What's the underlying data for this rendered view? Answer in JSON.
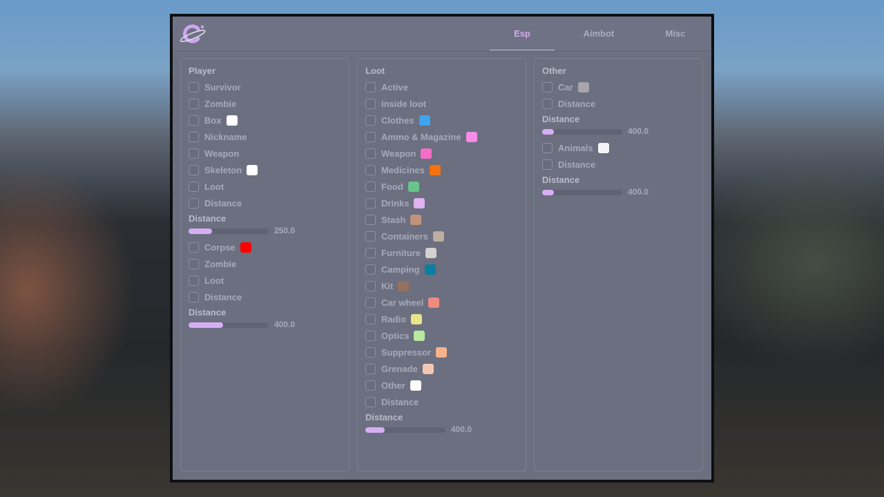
{
  "tabs": [
    {
      "label": "Esp",
      "active": true
    },
    {
      "label": "Aimbot",
      "active": false
    },
    {
      "label": "Misc",
      "active": false
    }
  ],
  "colors": {
    "accent": "#d7aef4",
    "panel_bg": "#6b6f80",
    "text": "#a6aab8"
  },
  "logo": {
    "icon": "planet-c-logo"
  },
  "player": {
    "title": "Player",
    "items": [
      {
        "label": "Survivor",
        "checked": false
      },
      {
        "label": "Zombie",
        "checked": false
      },
      {
        "label": "Box",
        "checked": false,
        "color": "#ffffff"
      },
      {
        "label": "Nickname",
        "checked": false
      },
      {
        "label": "Weapon",
        "checked": false
      },
      {
        "label": "Skeleton",
        "checked": false,
        "color": "#ffffff"
      },
      {
        "label": "Loot",
        "checked": false
      },
      {
        "label": "Distance",
        "checked": false
      }
    ],
    "slider1": {
      "label": "Distance",
      "value_text": "250.0",
      "fraction": 0.29
    },
    "items2": [
      {
        "label": "Corpse",
        "checked": false,
        "color": "#ff0000"
      },
      {
        "label": "Zombie",
        "checked": false
      },
      {
        "label": "Loot",
        "checked": false
      },
      {
        "label": "Distance",
        "checked": false
      }
    ],
    "slider2": {
      "label": "Distance",
      "value_text": "400.0",
      "fraction": 0.43
    }
  },
  "loot": {
    "title": "Loot",
    "items": [
      {
        "label": "Active",
        "checked": false
      },
      {
        "label": "Inside loot",
        "checked": false
      },
      {
        "label": "Clothes",
        "checked": false,
        "color": "#3fa4f2"
      },
      {
        "label": "Ammo & Magazine",
        "checked": false,
        "color": "#f78be8"
      },
      {
        "label": "Weapon",
        "checked": false,
        "color": "#f46ec8"
      },
      {
        "label": "Medicines",
        "checked": false,
        "color": "#f7720f"
      },
      {
        "label": "Food",
        "checked": false,
        "color": "#69c48c"
      },
      {
        "label": "Drinks",
        "checked": false,
        "color": "#e0b2ef"
      },
      {
        "label": "Stash",
        "checked": false,
        "color": "#c0937a"
      },
      {
        "label": "Containers",
        "checked": false,
        "color": "#bdaea0"
      },
      {
        "label": "Furniture",
        "checked": false,
        "color": "#d2d2d2"
      },
      {
        "label": "Camping",
        "checked": false,
        "color": "#0a7ea0"
      },
      {
        "label": "Kit",
        "checked": false,
        "color": "#94705e"
      },
      {
        "label": "Car wheel",
        "checked": false,
        "color": "#ee8a80"
      },
      {
        "label": "Radio",
        "checked": false,
        "color": "#e8e48a"
      },
      {
        "label": "Optics",
        "checked": false,
        "color": "#b9e9a0"
      },
      {
        "label": "Suppressor",
        "checked": false,
        "color": "#f7b38c"
      },
      {
        "label": "Grenade",
        "checked": false,
        "color": "#f2c8b4"
      },
      {
        "label": "Other",
        "checked": false,
        "color": "#ffffff"
      },
      {
        "label": "Distance",
        "checked": false
      }
    ],
    "slider": {
      "label": "Distance",
      "value_text": "400.0",
      "fraction": 0.24
    }
  },
  "other": {
    "title": "Other",
    "items": [
      {
        "label": "Car",
        "checked": false,
        "color": "#a9a5a8"
      },
      {
        "label": "Distance",
        "checked": false
      }
    ],
    "slider1": {
      "label": "Distance",
      "value_text": "400.0",
      "fraction": 0.15
    },
    "items2": [
      {
        "label": "Animals",
        "checked": false,
        "color": "#f4f4f6"
      },
      {
        "label": "Distance",
        "checked": false
      }
    ],
    "slider2": {
      "label": "Distance",
      "value_text": "400.0",
      "fraction": 0.15
    }
  }
}
